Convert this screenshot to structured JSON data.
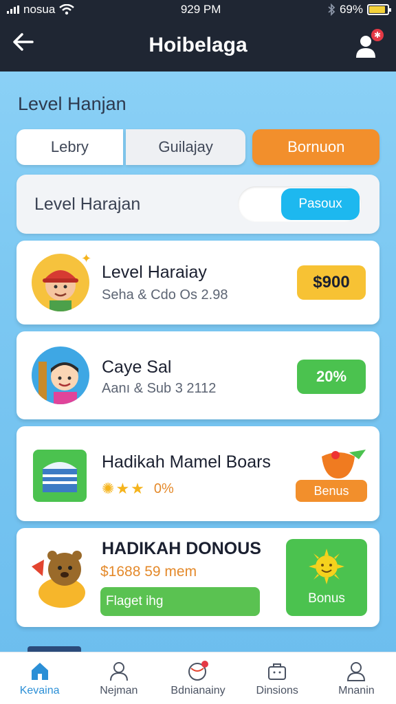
{
  "status": {
    "carrier": "nosua",
    "time": "929 PM",
    "battery": "69%"
  },
  "header": {
    "title": "Hoibelaga"
  },
  "section_title": "Level Hanjan",
  "tabs": [
    {
      "label": "Lebry"
    },
    {
      "label": "Guilajay"
    },
    {
      "label": "Bornuon"
    }
  ],
  "toggle_card": {
    "label": "Level Harajan",
    "toggle_value": "Pasoux"
  },
  "cards": [
    {
      "title": "Level Haraiay",
      "subtitle": "Seha & Cdo Os 2.98",
      "badge": "$900"
    },
    {
      "title": "Caye Sal",
      "subtitle": "Aanı & Sub 3 2112",
      "badge": "20%"
    },
    {
      "title": "Hadikah Mamel Boars",
      "rating": "0%",
      "button": "Benus"
    },
    {
      "title": "HADIKAH DONOUS",
      "price": "$1688 59 mem",
      "bar_label": "Flaget ihg",
      "tile_label": "Bonus"
    }
  ],
  "nav": [
    {
      "label": "Kevaina"
    },
    {
      "label": "Nejman"
    },
    {
      "label": "Bdnianainy"
    },
    {
      "label": "Dinsions"
    },
    {
      "label": "Mnanin"
    }
  ],
  "colors": {
    "header_bg": "#1f2633",
    "accent_orange": "#f28f2c",
    "accent_blue": "#1db8ef",
    "accent_green": "#4bc24f",
    "accent_yellow": "#f7c234",
    "nav_active": "#2b8fd6"
  }
}
